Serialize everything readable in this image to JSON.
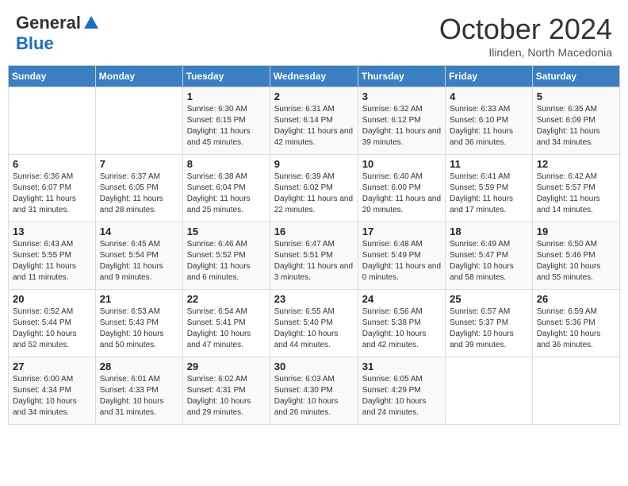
{
  "header": {
    "logo_general": "General",
    "logo_blue": "Blue",
    "month": "October 2024",
    "location": "Ilinden, North Macedonia"
  },
  "days_of_week": [
    "Sunday",
    "Monday",
    "Tuesday",
    "Wednesday",
    "Thursday",
    "Friday",
    "Saturday"
  ],
  "weeks": [
    [
      {
        "day": "",
        "info": ""
      },
      {
        "day": "",
        "info": ""
      },
      {
        "day": "1",
        "info": "Sunrise: 6:30 AM\nSunset: 6:15 PM\nDaylight: 11 hours and 45 minutes."
      },
      {
        "day": "2",
        "info": "Sunrise: 6:31 AM\nSunset: 6:14 PM\nDaylight: 11 hours and 42 minutes."
      },
      {
        "day": "3",
        "info": "Sunrise: 6:32 AM\nSunset: 6:12 PM\nDaylight: 11 hours and 39 minutes."
      },
      {
        "day": "4",
        "info": "Sunrise: 6:33 AM\nSunset: 6:10 PM\nDaylight: 11 hours and 36 minutes."
      },
      {
        "day": "5",
        "info": "Sunrise: 6:35 AM\nSunset: 6:09 PM\nDaylight: 11 hours and 34 minutes."
      }
    ],
    [
      {
        "day": "6",
        "info": "Sunrise: 6:36 AM\nSunset: 6:07 PM\nDaylight: 11 hours and 31 minutes."
      },
      {
        "day": "7",
        "info": "Sunrise: 6:37 AM\nSunset: 6:05 PM\nDaylight: 11 hours and 28 minutes."
      },
      {
        "day": "8",
        "info": "Sunrise: 6:38 AM\nSunset: 6:04 PM\nDaylight: 11 hours and 25 minutes."
      },
      {
        "day": "9",
        "info": "Sunrise: 6:39 AM\nSunset: 6:02 PM\nDaylight: 11 hours and 22 minutes."
      },
      {
        "day": "10",
        "info": "Sunrise: 6:40 AM\nSunset: 6:00 PM\nDaylight: 11 hours and 20 minutes."
      },
      {
        "day": "11",
        "info": "Sunrise: 6:41 AM\nSunset: 5:59 PM\nDaylight: 11 hours and 17 minutes."
      },
      {
        "day": "12",
        "info": "Sunrise: 6:42 AM\nSunset: 5:57 PM\nDaylight: 11 hours and 14 minutes."
      }
    ],
    [
      {
        "day": "13",
        "info": "Sunrise: 6:43 AM\nSunset: 5:55 PM\nDaylight: 11 hours and 11 minutes."
      },
      {
        "day": "14",
        "info": "Sunrise: 6:45 AM\nSunset: 5:54 PM\nDaylight: 11 hours and 9 minutes."
      },
      {
        "day": "15",
        "info": "Sunrise: 6:46 AM\nSunset: 5:52 PM\nDaylight: 11 hours and 6 minutes."
      },
      {
        "day": "16",
        "info": "Sunrise: 6:47 AM\nSunset: 5:51 PM\nDaylight: 11 hours and 3 minutes."
      },
      {
        "day": "17",
        "info": "Sunrise: 6:48 AM\nSunset: 5:49 PM\nDaylight: 11 hours and 0 minutes."
      },
      {
        "day": "18",
        "info": "Sunrise: 6:49 AM\nSunset: 5:47 PM\nDaylight: 10 hours and 58 minutes."
      },
      {
        "day": "19",
        "info": "Sunrise: 6:50 AM\nSunset: 5:46 PM\nDaylight: 10 hours and 55 minutes."
      }
    ],
    [
      {
        "day": "20",
        "info": "Sunrise: 6:52 AM\nSunset: 5:44 PM\nDaylight: 10 hours and 52 minutes."
      },
      {
        "day": "21",
        "info": "Sunrise: 6:53 AM\nSunset: 5:43 PM\nDaylight: 10 hours and 50 minutes."
      },
      {
        "day": "22",
        "info": "Sunrise: 6:54 AM\nSunset: 5:41 PM\nDaylight: 10 hours and 47 minutes."
      },
      {
        "day": "23",
        "info": "Sunrise: 6:55 AM\nSunset: 5:40 PM\nDaylight: 10 hours and 44 minutes."
      },
      {
        "day": "24",
        "info": "Sunrise: 6:56 AM\nSunset: 5:38 PM\nDaylight: 10 hours and 42 minutes."
      },
      {
        "day": "25",
        "info": "Sunrise: 6:57 AM\nSunset: 5:37 PM\nDaylight: 10 hours and 39 minutes."
      },
      {
        "day": "26",
        "info": "Sunrise: 6:59 AM\nSunset: 5:36 PM\nDaylight: 10 hours and 36 minutes."
      }
    ],
    [
      {
        "day": "27",
        "info": "Sunrise: 6:00 AM\nSunset: 4:34 PM\nDaylight: 10 hours and 34 minutes."
      },
      {
        "day": "28",
        "info": "Sunrise: 6:01 AM\nSunset: 4:33 PM\nDaylight: 10 hours and 31 minutes."
      },
      {
        "day": "29",
        "info": "Sunrise: 6:02 AM\nSunset: 4:31 PM\nDaylight: 10 hours and 29 minutes."
      },
      {
        "day": "30",
        "info": "Sunrise: 6:03 AM\nSunset: 4:30 PM\nDaylight: 10 hours and 26 minutes."
      },
      {
        "day": "31",
        "info": "Sunrise: 6:05 AM\nSunset: 4:29 PM\nDaylight: 10 hours and 24 minutes."
      },
      {
        "day": "",
        "info": ""
      },
      {
        "day": "",
        "info": ""
      }
    ]
  ]
}
